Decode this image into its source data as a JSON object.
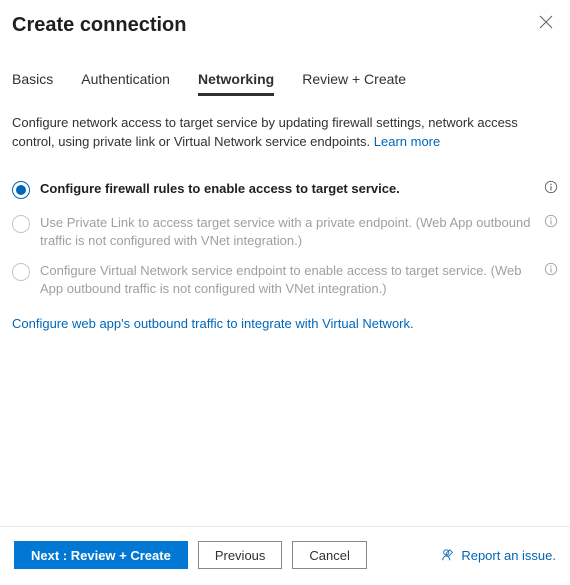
{
  "header": {
    "title": "Create connection"
  },
  "tabs": {
    "basics": "Basics",
    "authentication": "Authentication",
    "networking": "Networking",
    "review": "Review + Create",
    "active": "networking"
  },
  "description": {
    "text": "Configure network access to target service by updating firewall settings, network access control, using private link or Virtual Network service endpoints. ",
    "learn_more": "Learn more"
  },
  "options": {
    "firewall": {
      "label": "Configure firewall rules to enable access to target service.",
      "checked": true,
      "enabled": true
    },
    "private_link": {
      "label": "Use Private Link to access target service with a private endpoint. (Web App  outbound traffic is not configured with VNet integration.)",
      "checked": false,
      "enabled": false
    },
    "vnet": {
      "label": "Configure Virtual Network service endpoint to enable access to target service. (Web App outbound traffic is not configured with VNet integration.)",
      "checked": false,
      "enabled": false
    }
  },
  "vnet_link": "Configure web app's outbound traffic to integrate with Virtual Network.",
  "footer": {
    "next": "Next : Review + Create",
    "previous": "Previous",
    "cancel": "Cancel",
    "report": "Report an issue."
  }
}
